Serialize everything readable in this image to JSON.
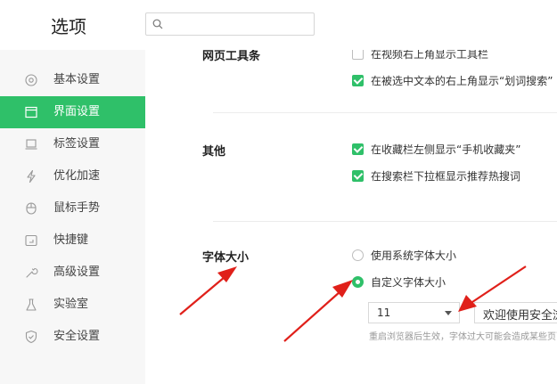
{
  "header": {
    "title": "选项",
    "search": {
      "value": "",
      "placeholder": ""
    }
  },
  "sidebar": {
    "items": [
      {
        "label": "基本设置",
        "icon": "settings-icon",
        "active": false
      },
      {
        "label": "界面设置",
        "icon": "window-icon",
        "active": true
      },
      {
        "label": "标签设置",
        "icon": "tab-icon",
        "active": false
      },
      {
        "label": "优化加速",
        "icon": "lightning-icon",
        "active": false
      },
      {
        "label": "鼠标手势",
        "icon": "mouse-icon",
        "active": false
      },
      {
        "label": "快捷键",
        "icon": "keyboard-icon",
        "active": false
      },
      {
        "label": "高级设置",
        "icon": "wrench-icon",
        "active": false
      },
      {
        "label": "实验室",
        "icon": "flask-icon",
        "active": false
      },
      {
        "label": "安全设置",
        "icon": "shield-icon",
        "active": false
      }
    ]
  },
  "sections": {
    "toolbar": {
      "label": "网页工具条",
      "options": [
        {
          "text": "在视频右上角显示工具栏",
          "checked": false
        },
        {
          "text": "在被选中文本的右上角显示“划词搜索”",
          "checked": true
        }
      ]
    },
    "other": {
      "label": "其他",
      "options": [
        {
          "text": "在收藏栏左侧显示“手机收藏夹”",
          "checked": true
        },
        {
          "text": "在搜索栏下拉框显示推荐热搜词",
          "checked": true
        }
      ]
    },
    "font_size": {
      "label": "字体大小",
      "options": [
        {
          "text": "使用系统字体大小",
          "selected": false
        },
        {
          "text": "自定义字体大小",
          "selected": true
        }
      ],
      "size_value": "11",
      "preview_text": "欢迎使用安全浏览器",
      "hint": "重启浏览器后生效，字体过大可能会造成某些页面显示异常"
    }
  },
  "colors": {
    "accent": "#2fc069",
    "annotation_arrow": "#e0201a"
  }
}
